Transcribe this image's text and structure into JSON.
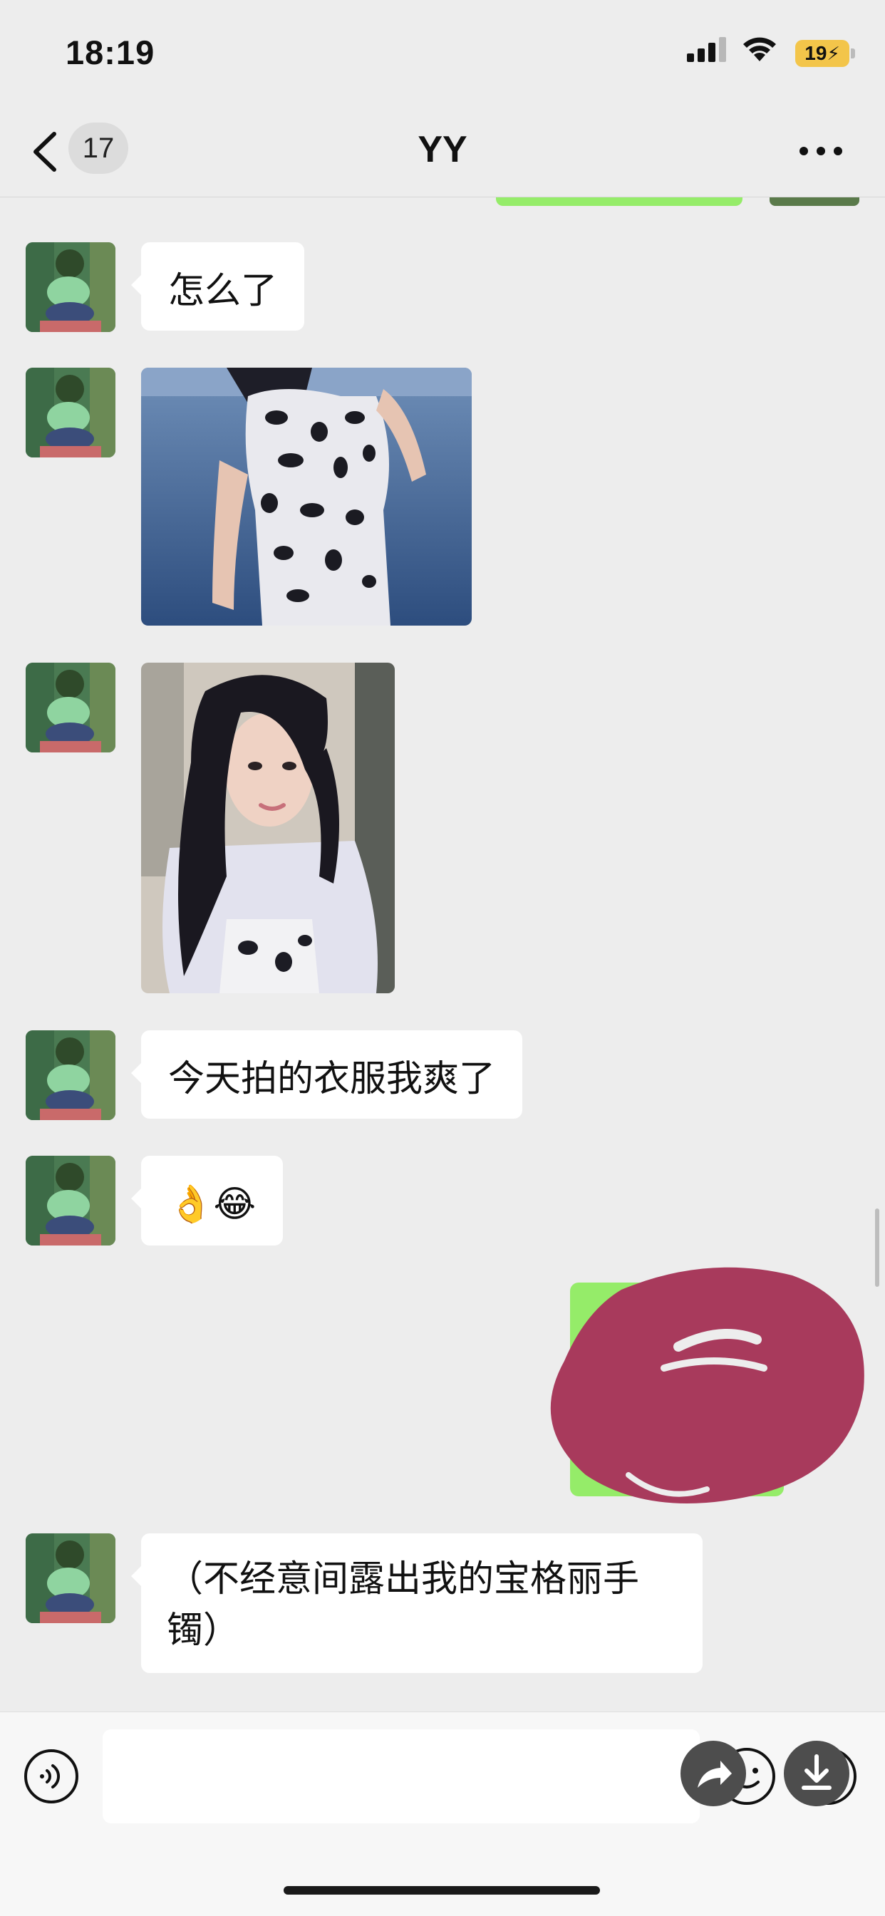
{
  "status_bar": {
    "time": "18:19",
    "battery": "19"
  },
  "nav": {
    "unread_count": "17",
    "title": "YY"
  },
  "messages": [
    {
      "type": "text",
      "from": "contact",
      "text": "怎么了"
    },
    {
      "type": "image",
      "from": "contact",
      "description_icon": "photo-swimsuit-pool"
    },
    {
      "type": "image",
      "from": "contact",
      "description_icon": "photo-selfie"
    },
    {
      "type": "text",
      "from": "contact",
      "text": "今天拍的衣服我爽了"
    },
    {
      "type": "text",
      "from": "contact",
      "text": "👌😂"
    },
    {
      "type": "redacted",
      "from": "self"
    },
    {
      "type": "text",
      "from": "contact",
      "text": "（不经意间露出我的宝格丽手镯）"
    }
  ],
  "input": {
    "placeholder": ""
  },
  "colors": {
    "background": "#ededed",
    "bubble": "#ffffff",
    "self_bubble": "#95ec69",
    "redaction": "#a83a5c"
  }
}
